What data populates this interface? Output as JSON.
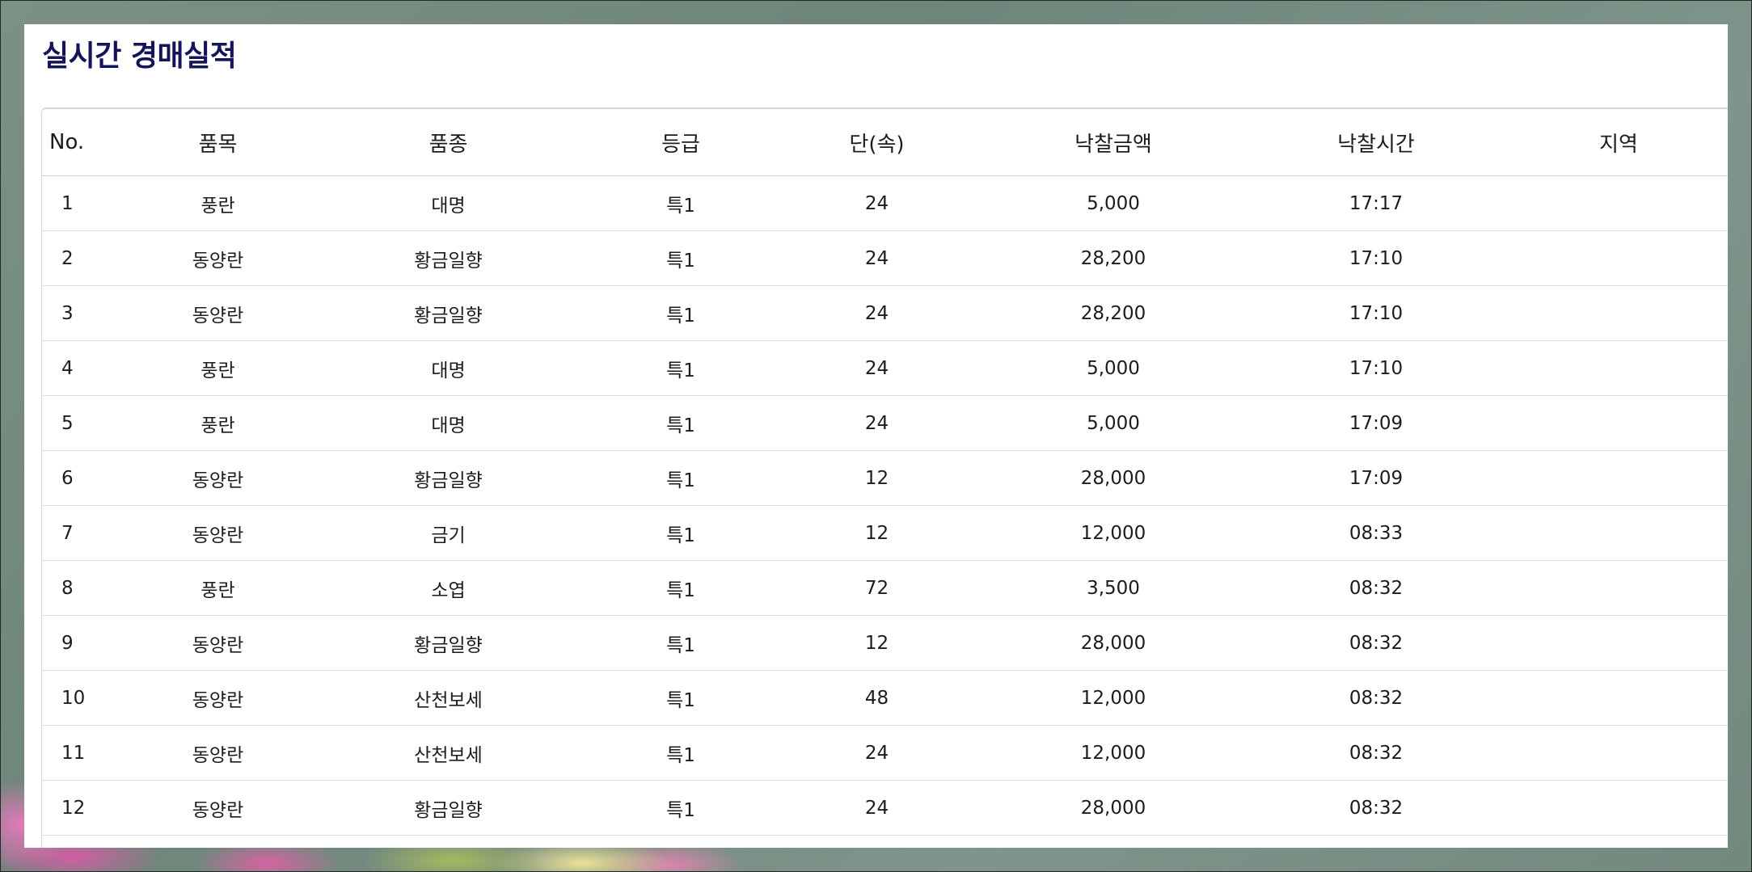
{
  "title": "실시간 경매실적",
  "table": {
    "headers": [
      "No.",
      "품목",
      "품종",
      "등급",
      "단(속)",
      "낙찰금액",
      "낙찰시간",
      "지역"
    ],
    "rows": [
      [
        "1",
        "풍란",
        "대명",
        "특1",
        "24",
        "5,000",
        "17:17",
        ""
      ],
      [
        "2",
        "동양란",
        "황금일향",
        "특1",
        "24",
        "28,200",
        "17:10",
        ""
      ],
      [
        "3",
        "동양란",
        "황금일향",
        "특1",
        "24",
        "28,200",
        "17:10",
        ""
      ],
      [
        "4",
        "풍란",
        "대명",
        "특1",
        "24",
        "5,000",
        "17:10",
        ""
      ],
      [
        "5",
        "풍란",
        "대명",
        "특1",
        "24",
        "5,000",
        "17:09",
        ""
      ],
      [
        "6",
        "동양란",
        "황금일향",
        "특1",
        "12",
        "28,000",
        "17:09",
        ""
      ],
      [
        "7",
        "동양란",
        "금기",
        "특1",
        "12",
        "12,000",
        "08:33",
        ""
      ],
      [
        "8",
        "풍란",
        "소엽",
        "특1",
        "72",
        "3,500",
        "08:32",
        ""
      ],
      [
        "9",
        "동양란",
        "황금일향",
        "특1",
        "12",
        "28,000",
        "08:32",
        ""
      ],
      [
        "10",
        "동양란",
        "산천보세",
        "특1",
        "48",
        "12,000",
        "08:32",
        ""
      ],
      [
        "11",
        "동양란",
        "산천보세",
        "특1",
        "24",
        "12,000",
        "08:32",
        ""
      ],
      [
        "12",
        "동양란",
        "황금일향",
        "특1",
        "24",
        "28,000",
        "08:32",
        ""
      ]
    ]
  }
}
